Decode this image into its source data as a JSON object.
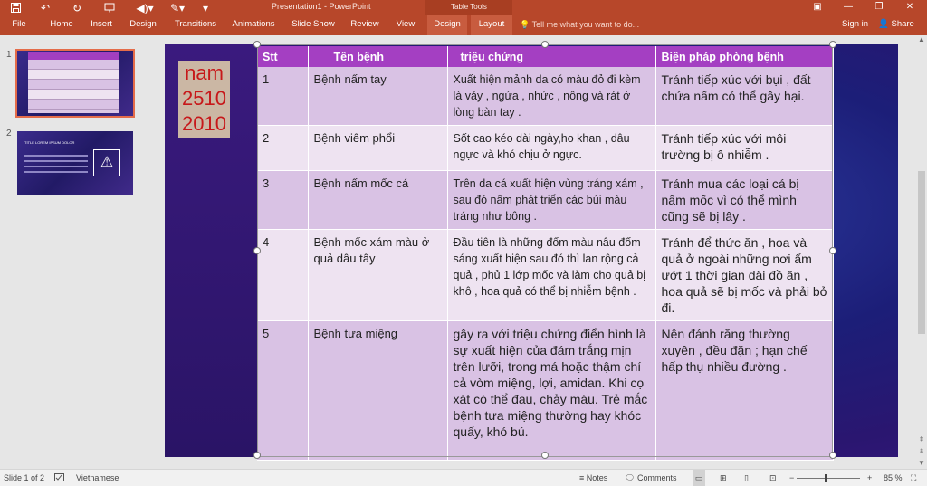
{
  "app": {
    "window_title": "Presentation1 - PowerPoint",
    "contextual_group": "Table Tools"
  },
  "qat": {
    "save_icon": "save-icon",
    "undo_icon": "undo-icon",
    "redo_icon": "redo-icon",
    "start_from_beginning_icon": "present-icon",
    "audio_icon": "speaker-icon",
    "draw_icon": "pen-icon"
  },
  "window_controls": {
    "restore_ribbon": "▣",
    "minimize": "—",
    "maximize": "❐",
    "close": "✕"
  },
  "ribbon": {
    "tabs": [
      {
        "label": "File"
      },
      {
        "label": "Home"
      },
      {
        "label": "Insert"
      },
      {
        "label": "Design"
      },
      {
        "label": "Transitions"
      },
      {
        "label": "Animations"
      },
      {
        "label": "Slide Show"
      },
      {
        "label": "Review"
      },
      {
        "label": "View"
      },
      {
        "label": "Design"
      },
      {
        "label": "Layout"
      }
    ],
    "tell_me": "Tell me what you want to do...",
    "sign_in": "Sign in",
    "share": "Share"
  },
  "thumbnails": {
    "items": [
      {
        "number": "1",
        "selected": true
      },
      {
        "number": "2",
        "selected": false,
        "title": "TITLE LOREM IPSUM DOLOR"
      }
    ]
  },
  "slide": {
    "year_box": [
      "nam",
      "2510",
      "2010"
    ],
    "table": {
      "headers": [
        "Stt",
        "Tên bệnh",
        "triệu chứng",
        "Biện pháp phòng bệnh"
      ],
      "rows": [
        [
          "1",
          "Bệnh nấm tay",
          "Xuất hiện mảnh da có màu đỏ đi kèm là vảy , ngứa , nhức , nống và rát ở lòng bàn tay .",
          "Tránh tiếp xúc với bụi , đất chứa nấm có thể gây hại."
        ],
        [
          "2",
          "Bệnh viêm phổi",
          "Sốt cao kéo dài ngày,ho khan , dâu ngực và khó chịu ở ngực.",
          "Tránh tiếp xúc với môi trường bị ô nhiễm ."
        ],
        [
          "3",
          "Bệnh nấm mốc cá",
          "Trên da cá xuất hiện vùng tráng xám , sau đó nấm phát triển các búi màu tráng như bông .",
          "Tránh mua các loại cá bị nấm mốc vì có thể mình cũng sẽ bị lây ."
        ],
        [
          "4",
          "Bệnh mốc xám màu ở quả dâu tây",
          "Đầu tiên là những đốm màu nâu đốm sáng xuất hiện sau đó thì lan rộng cả quả , phủ 1 lớp mốc và làm cho quả bị khô , hoa quả có thể bị nhiễm bệnh .",
          "Tránh để thức ăn , hoa và quả ở ngoài những nơi ẩm ướt 1 thời gian dài đồ ăn , hoa quả sẽ bị mốc và phải bỏ đi."
        ],
        [
          "5",
          "Bệnh tưa miệng",
          "gây ra với triệu chứng điển hình là sự xuất hiện của đám trắng mịn trên lưỡi, trong má hoặc thậm chí cả vòm miệng, lợi, amidan. Khi cọ xát có thể đau, chảy máu. Trẻ mắc bệnh tưa miệng thường hay khóc quấy, khó bú.",
          "Nên đánh răng thường xuyên , đều đặn ; hạn chế hấp thụ nhiều đường ."
        ]
      ]
    }
  },
  "status_bar": {
    "slide_info": "Slide 1 of 2",
    "language": "Vietnamese",
    "notes": "Notes",
    "comments": "Comments",
    "zoom_minus": "−",
    "zoom_plus": "+",
    "zoom": "85 %"
  },
  "colors": {
    "ribbon": "#b7472a",
    "table_header": "#a43fc2",
    "row_odd": "#d9c2e4",
    "row_even": "#eee3f1",
    "year_text": "#c7181a"
  }
}
